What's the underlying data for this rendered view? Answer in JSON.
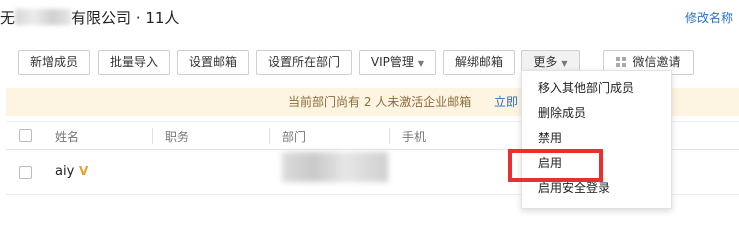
{
  "header": {
    "title_prefix": "无",
    "title_suffix": "有限公司",
    "member_count": "· 11人",
    "edit_name_link": "修改名称"
  },
  "toolbar": {
    "add_member": "新增成员",
    "batch_import": "批量导入",
    "set_mailbox": "设置邮箱",
    "set_department": "设置所在部门",
    "vip_manage": "VIP管理",
    "unbind_mailbox": "解绑邮箱",
    "more": "更多",
    "wechat_invite": "微信邀请"
  },
  "notice": {
    "text": "当前部门尚有 2 人未激活企业邮箱",
    "link": "立即"
  },
  "table": {
    "columns": [
      "姓名",
      "职务",
      "部门",
      "手机"
    ],
    "rows": [
      {
        "name": "aiy",
        "vip_badge": "V"
      }
    ]
  },
  "more_menu": {
    "items": [
      "移入其他部门成员",
      "删除成员",
      "禁用",
      "启用",
      "启用安全登录"
    ]
  },
  "colors": {
    "link": "#2a6fc9",
    "notice_bg": "#fdf4e2",
    "highlight": "#e8302e",
    "vip": "#e4a12b"
  }
}
